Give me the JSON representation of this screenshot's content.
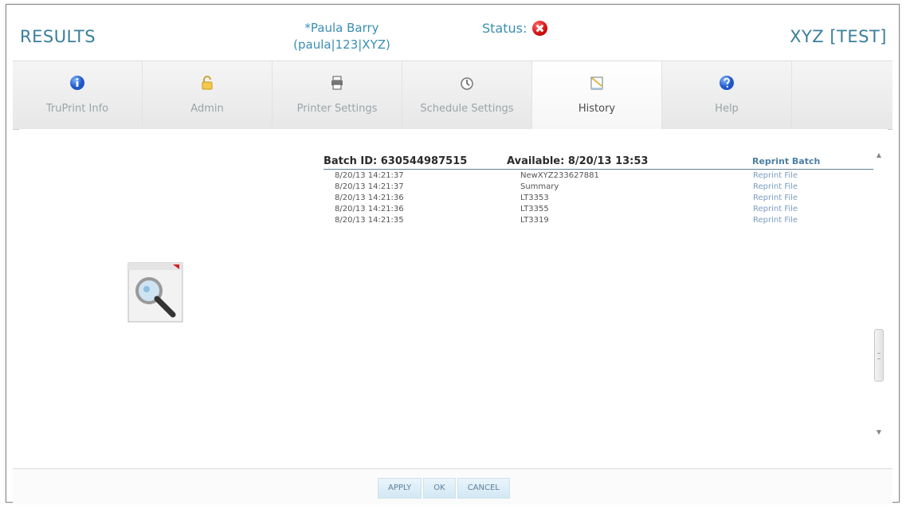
{
  "header": {
    "title": "RESULTS",
    "user_name": "*Paula Barry",
    "user_id": "(paula|123|XYZ)",
    "status_label": "Status:",
    "status_icon": "error-icon",
    "environment": "XYZ [TEST]"
  },
  "tabs": [
    {
      "label": "TruPrint Info",
      "icon": "info-icon"
    },
    {
      "label": "Admin",
      "icon": "lock-icon"
    },
    {
      "label": "Printer Settings",
      "icon": "printer-icon"
    },
    {
      "label": "Schedule Settings",
      "icon": "clock-icon"
    },
    {
      "label": "History",
      "icon": "history-icon",
      "active": true
    },
    {
      "label": "Help",
      "icon": "help-icon"
    }
  ],
  "history": {
    "batch_id": "Batch ID: 630544987515",
    "available": "Available: 8/20/13 13:53",
    "reprint_batch": "Reprint Batch",
    "rows": [
      {
        "time": "8/20/13 14:21:37",
        "file": "NewXYZ233627881",
        "action": "Reprint File"
      },
      {
        "time": "8/20/13 14:21:37",
        "file": "Summary",
        "action": "Reprint File"
      },
      {
        "time": "8/20/13 14:21:36",
        "file": "LT3353",
        "action": "Reprint File"
      },
      {
        "time": "8/20/13 14:21:36",
        "file": "LT3355",
        "action": "Reprint File"
      },
      {
        "time": "8/20/13 14:21:35",
        "file": "LT3319",
        "action": "Reprint File"
      }
    ]
  },
  "footer": {
    "apply": "APPLY",
    "ok": "OK",
    "cancel": "CANCEL"
  },
  "colors": {
    "accent": "#3a7f9c",
    "link": "#7b9cc0",
    "status_error": "#d31010"
  }
}
